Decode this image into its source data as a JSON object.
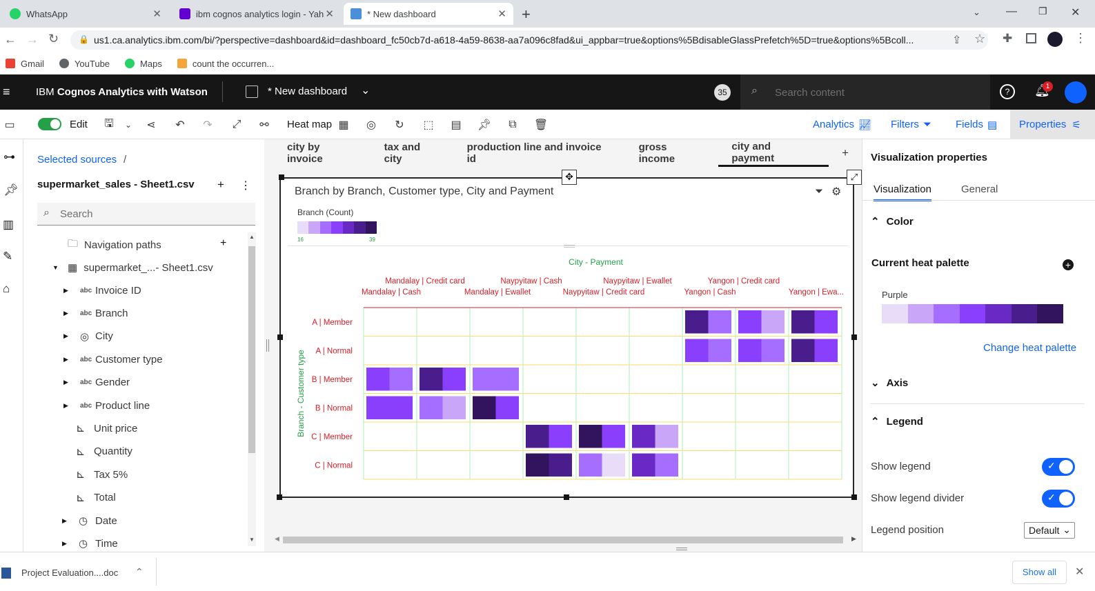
{
  "browser": {
    "tabs": [
      {
        "title": "WhatsApp"
      },
      {
        "title": "ibm cognos analytics login - Yah"
      },
      {
        "title": "* New dashboard"
      }
    ],
    "new_tab": "+",
    "url": "us1.ca.analytics.ibm.com/bi/?perspective=dashboard&id=dashboard_fc50cb7d-a618-4a59-8638-aa7a096c8fad&ui_appbar=true&options%5BdisableGlassPrefetch%5D=true&options%5Bcoll...",
    "bookmarks": [
      "Gmail",
      "YouTube",
      "Maps",
      "count the occurren..."
    ]
  },
  "app": {
    "brand_prefix": "IBM ",
    "brand_bold": "Cognos Analytics with Watson",
    "dashboard_title": "* New dashboard",
    "badge": "35",
    "search_placeholder": "Search content",
    "notifications": "1"
  },
  "toolbar": {
    "edit_label": "Edit",
    "viz_type": "Heat map",
    "analytics": "Analytics",
    "filters": "Filters",
    "fields": "Fields",
    "properties": "Properties"
  },
  "sources": {
    "breadcrumb": "Selected sources",
    "breadcrumb_sep": "/",
    "file": "supermarket_sales - Sheet1.csv",
    "search_placeholder": "Search",
    "nav_paths": "Navigation paths",
    "table": "supermarket_...- Sheet1.csv",
    "fields": [
      {
        "label": "Invoice ID",
        "type": "abc"
      },
      {
        "label": "Branch",
        "type": "abc"
      },
      {
        "label": "City",
        "type": "geo"
      },
      {
        "label": "Customer type",
        "type": "abc"
      },
      {
        "label": "Gender",
        "type": "abc"
      },
      {
        "label": "Product line",
        "type": "abc"
      },
      {
        "label": "Unit price",
        "type": "measure"
      },
      {
        "label": "Quantity",
        "type": "measure"
      },
      {
        "label": "Tax 5%",
        "type": "measure"
      },
      {
        "label": "Total",
        "type": "measure"
      },
      {
        "label": "Date",
        "type": "time"
      },
      {
        "label": "Time",
        "type": "time"
      }
    ]
  },
  "view_tabs": [
    "city by invoice",
    "tax and city",
    "production line and invoice id",
    "gross income",
    "city and payment"
  ],
  "view_tabs_add": "+",
  "viz": {
    "title": "Branch by Branch, Customer type, City and Payment",
    "legend_title": "Branch (Count)",
    "legend_min": "16",
    "legend_max": "39",
    "col_axis_title": "City - Payment",
    "row_axis_title": "Branch - Customer type",
    "columns_top": [
      "Mandalay | Credit card",
      "Naypyitaw | Cash",
      "Naypyitaw | Ewallet",
      "Yangon | Credit card"
    ],
    "columns_bottom": [
      "Mandalay | Cash",
      "Mandalay | Ewallet",
      "Naypyitaw | Credit card",
      "Yangon | Cash",
      "Yangon | Ewa..."
    ],
    "rows": [
      "A | Member",
      "A | Normal",
      "B | Member",
      "B | Normal",
      "C | Member",
      "C | Normal"
    ]
  },
  "chart_data": {
    "type": "heatmap",
    "title": "Branch by Branch, Customer type, City and Payment",
    "ylabel": "Branch - Customer type",
    "xlabel": "City - Payment",
    "legend": "Branch (Count)",
    "range": [
      16,
      39
    ],
    "palette": [
      "#e8dcf8",
      "#c9a6f7",
      "#a56eff",
      "#8a3ffc",
      "#6929c4",
      "#491d8b",
      "#31135e"
    ],
    "rows": [
      "A | Member",
      "A | Normal",
      "B | Member",
      "B | Normal",
      "C | Member",
      "C | Normal"
    ],
    "columns": [
      "Mandalay | Cash",
      "Mandalay | Credit card",
      "Mandalay | Ewallet",
      "Naypyitaw | Cash",
      "Naypyitaw | Credit card",
      "Naypyitaw | Ewallet",
      "Yangon | Cash",
      "Yangon | Credit card",
      "Yangon | Ewallet"
    ],
    "cells": [
      {
        "row": 0,
        "col": 6,
        "shades": [
          5,
          2
        ]
      },
      {
        "row": 0,
        "col": 7,
        "shades": [
          3,
          1
        ]
      },
      {
        "row": 0,
        "col": 8,
        "shades": [
          5,
          3
        ]
      },
      {
        "row": 1,
        "col": 6,
        "shades": [
          3,
          2
        ]
      },
      {
        "row": 1,
        "col": 7,
        "shades": [
          3,
          2
        ]
      },
      {
        "row": 1,
        "col": 8,
        "shades": [
          5,
          3
        ]
      },
      {
        "row": 2,
        "col": 0,
        "shades": [
          3,
          2
        ]
      },
      {
        "row": 2,
        "col": 1,
        "shades": [
          5,
          3
        ]
      },
      {
        "row": 2,
        "col": 2,
        "shades": [
          2,
          2
        ]
      },
      {
        "row": 3,
        "col": 0,
        "shades": [
          3,
          3
        ]
      },
      {
        "row": 3,
        "col": 1,
        "shades": [
          2,
          1
        ]
      },
      {
        "row": 3,
        "col": 2,
        "shades": [
          6,
          3
        ]
      },
      {
        "row": 4,
        "col": 3,
        "shades": [
          5,
          3
        ]
      },
      {
        "row": 4,
        "col": 4,
        "shades": [
          6,
          3
        ]
      },
      {
        "row": 4,
        "col": 5,
        "shades": [
          4,
          1
        ]
      },
      {
        "row": 5,
        "col": 3,
        "shades": [
          6,
          5
        ]
      },
      {
        "row": 5,
        "col": 4,
        "shades": [
          2,
          0
        ]
      },
      {
        "row": 5,
        "col": 5,
        "shades": [
          4,
          2
        ]
      }
    ]
  },
  "properties": {
    "title": "Visualization properties",
    "tabs": [
      "Visualization",
      "General"
    ],
    "color_section": "Color",
    "heat_palette_label": "Current heat palette",
    "palette_name": "Purple",
    "change_palette": "Change heat palette",
    "axis_section": "Axis",
    "legend_section": "Legend",
    "show_legend": "Show legend",
    "show_legend_divider": "Show legend divider",
    "legend_position": "Legend position",
    "legend_position_value": "Default"
  },
  "downloads": {
    "file": "Project Evaluation....doc",
    "show_all": "Show all"
  }
}
